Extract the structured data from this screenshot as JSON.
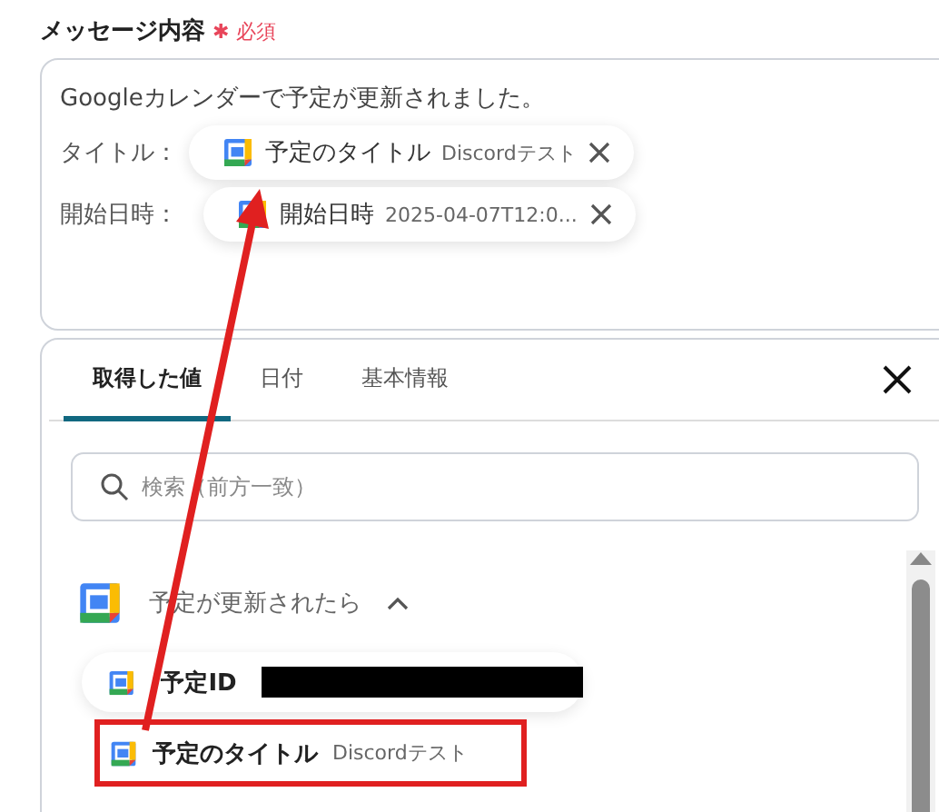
{
  "field": {
    "label": "メッセージ内容",
    "required_mark": "✱",
    "required": "必須"
  },
  "message": {
    "intro": "Googleカレンダーで予定が更新されました。",
    "lines": [
      {
        "prefix": "タイトル：",
        "name": "予定のタイトル",
        "value": "Discordテスト"
      },
      {
        "prefix": "開始日時：",
        "name": "開始日時",
        "value": "2025-04-07T12:0..."
      }
    ]
  },
  "panel": {
    "tabs": [
      {
        "label": "取得した値",
        "selected": true
      },
      {
        "label": "日付",
        "selected": false
      },
      {
        "label": "基本情報",
        "selected": false
      }
    ],
    "search": {
      "placeholder": "検索（前方一致）"
    },
    "group": {
      "title": "予定が更新されたら",
      "expanded": true
    },
    "items": [
      {
        "kind": "redacted",
        "name": "予定ID",
        "highlighted": false
      },
      {
        "kind": "value",
        "name": "予定のタイトル",
        "value": "Discordテスト",
        "highlighted": true
      }
    ]
  }
}
